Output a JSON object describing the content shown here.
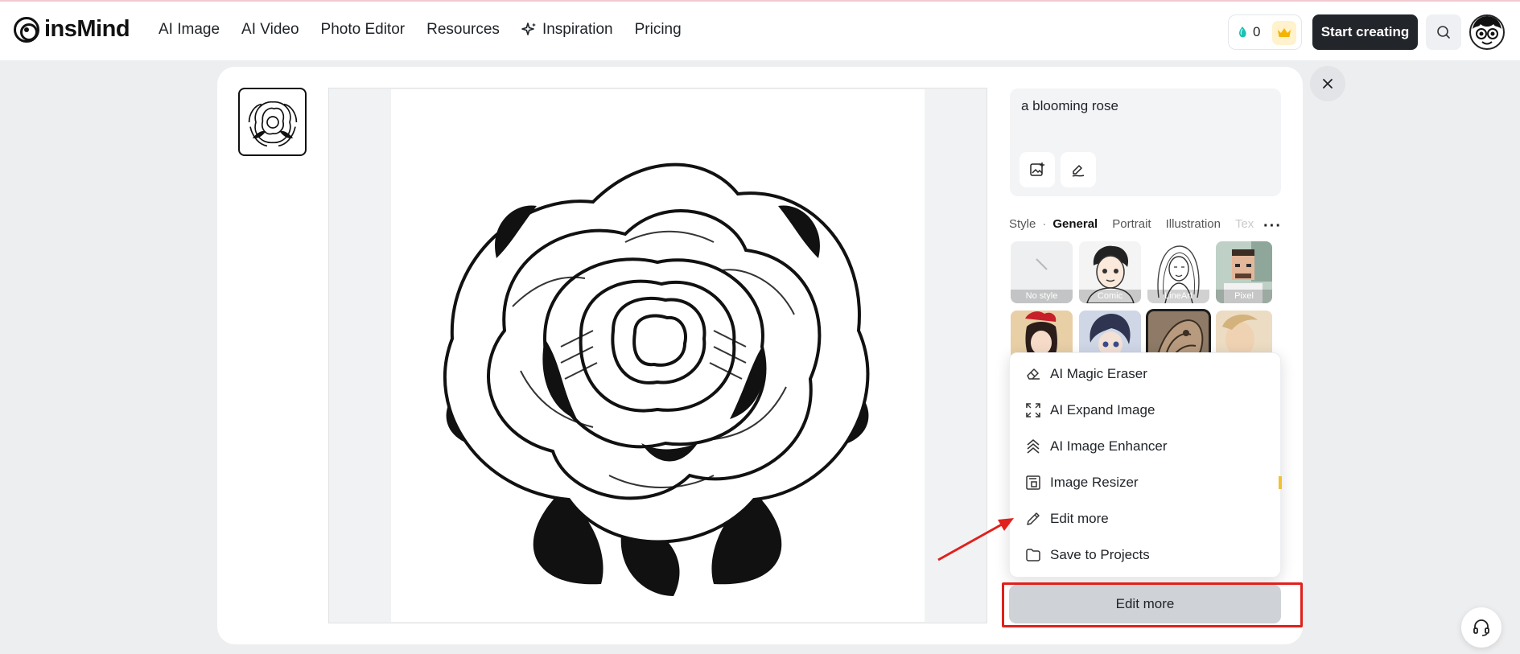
{
  "brand": {
    "name": "insMind"
  },
  "nav": {
    "items": [
      {
        "label": "AI Image"
      },
      {
        "label": "AI Video"
      },
      {
        "label": "Photo Editor"
      },
      {
        "label": "Resources"
      },
      {
        "label": "Inspiration",
        "icon": "sparkle-icon"
      },
      {
        "label": "Pricing"
      }
    ]
  },
  "header": {
    "credits": "0",
    "start_label": "Start creating"
  },
  "prompt": {
    "text": "a blooming rose"
  },
  "styles": {
    "label": "Style",
    "tabs": [
      {
        "label": "General",
        "active": true
      },
      {
        "label": "Portrait"
      },
      {
        "label": "Illustration"
      },
      {
        "label": "Tex",
        "faded": true
      }
    ],
    "tiles": [
      {
        "label": "No style"
      },
      {
        "label": "Comic"
      },
      {
        "label": "LineArt"
      },
      {
        "label": "Pixel"
      }
    ]
  },
  "menu": {
    "items": [
      {
        "label": "AI Magic Eraser",
        "icon": "eraser-icon"
      },
      {
        "label": "AI Expand Image",
        "icon": "expand-icon"
      },
      {
        "label": "AI Image Enhancer",
        "icon": "enhance-icon"
      },
      {
        "label": "Image Resizer",
        "icon": "resize-icon"
      },
      {
        "label": "Edit more",
        "icon": "pencil-icon"
      },
      {
        "label": "Save to Projects",
        "icon": "folder-icon"
      }
    ]
  },
  "actions": {
    "edit_more_label": "Edit more"
  },
  "colors": {
    "accent_dark": "#22252a",
    "highlight_red": "#e0201c",
    "credit_teal": "#19c2b3",
    "crown_gold": "#f5b400"
  }
}
